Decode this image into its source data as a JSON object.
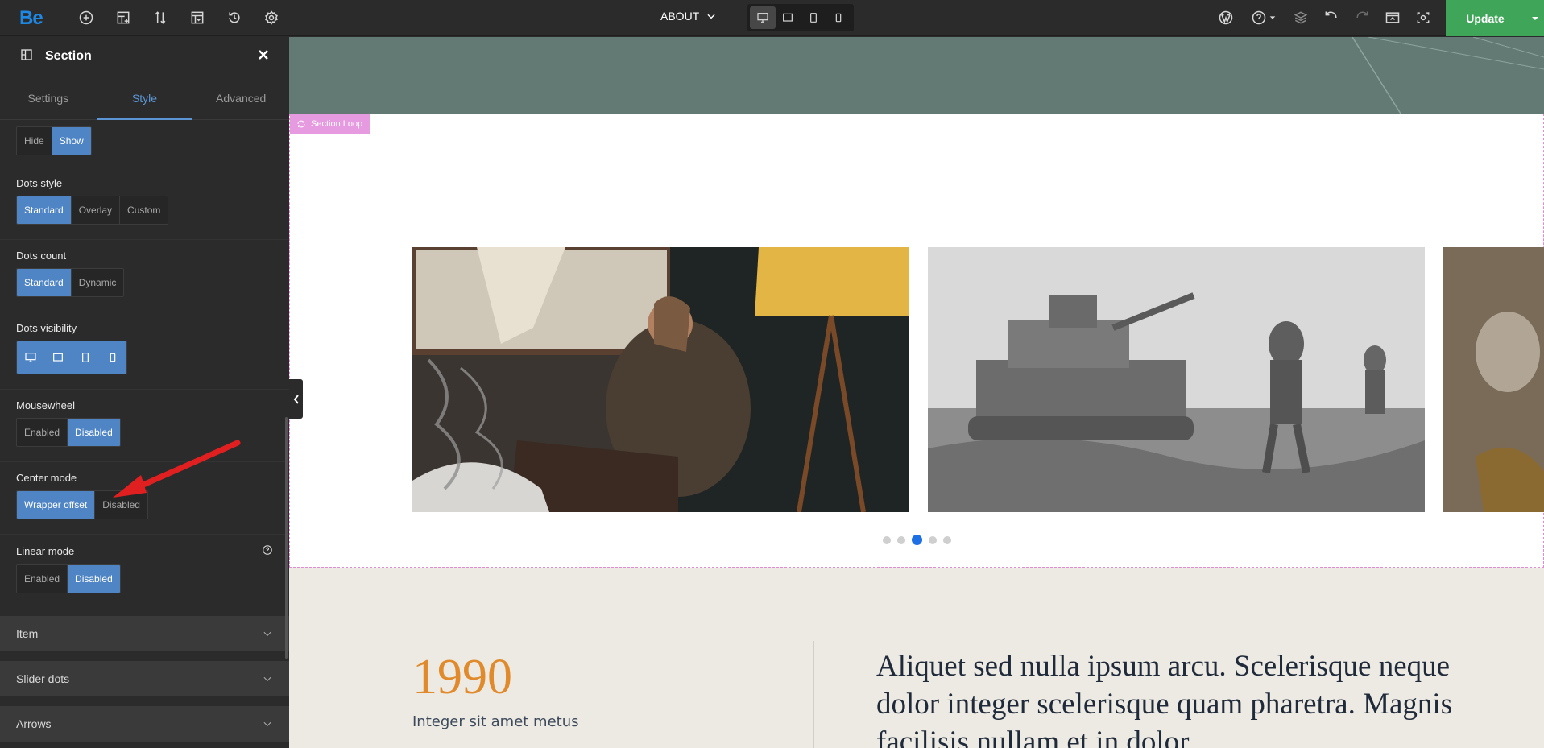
{
  "topbar": {
    "logo": "Be",
    "page_name": "ABOUT",
    "update_label": "Update",
    "icons": [
      "add-icon",
      "layout-icon",
      "sort-icon",
      "template-icon",
      "history-icon",
      "settings-icon",
      "wordpress-icon",
      "help-icon",
      "layers-icon",
      "undo-icon",
      "redo-icon",
      "preview-icon",
      "live-preview-icon"
    ]
  },
  "sidebar": {
    "title": "Section",
    "tabs": [
      "Settings",
      "Style",
      "Advanced"
    ],
    "active_tab": "Style",
    "options": {
      "dots_toggle": {
        "hide": "Hide",
        "show": "Show"
      },
      "dots_style": {
        "label": "Dots style",
        "standard": "Standard",
        "overlay": "Overlay",
        "custom": "Custom"
      },
      "dots_count": {
        "label": "Dots count",
        "standard": "Standard",
        "dynamic": "Dynamic"
      },
      "dots_visibility": {
        "label": "Dots visibility"
      },
      "mousewheel": {
        "label": "Mousewheel",
        "enabled": "Enabled",
        "disabled": "Disabled"
      },
      "center_mode": {
        "label": "Center mode",
        "wrapper_offset": "Wrapper offset",
        "disabled": "Disabled"
      },
      "linear_mode": {
        "label": "Linear mode",
        "enabled": "Enabled",
        "disabled": "Disabled"
      }
    },
    "accordions": [
      "Item",
      "Slider dots",
      "Arrows"
    ]
  },
  "canvas": {
    "loop_badge": "Section Loop",
    "slider": {
      "dot_count": 5,
      "active_dot": 3
    },
    "year": "1990",
    "year_subtitle": "Integer sit amet metus",
    "quote": "Aliquet sed nulla ipsum arcu. Scelerisque neque dolor integer scelerisque quam pharetra. Magnis facilisis nullam et in dolor"
  },
  "colors": {
    "accent": "#4f85c5",
    "update": "#3fa659",
    "hero": "#637a74",
    "beige": "#edeae3",
    "year": "#e08a2b",
    "loop": "#e69ae0",
    "dot_active": "#1e6fe3"
  }
}
